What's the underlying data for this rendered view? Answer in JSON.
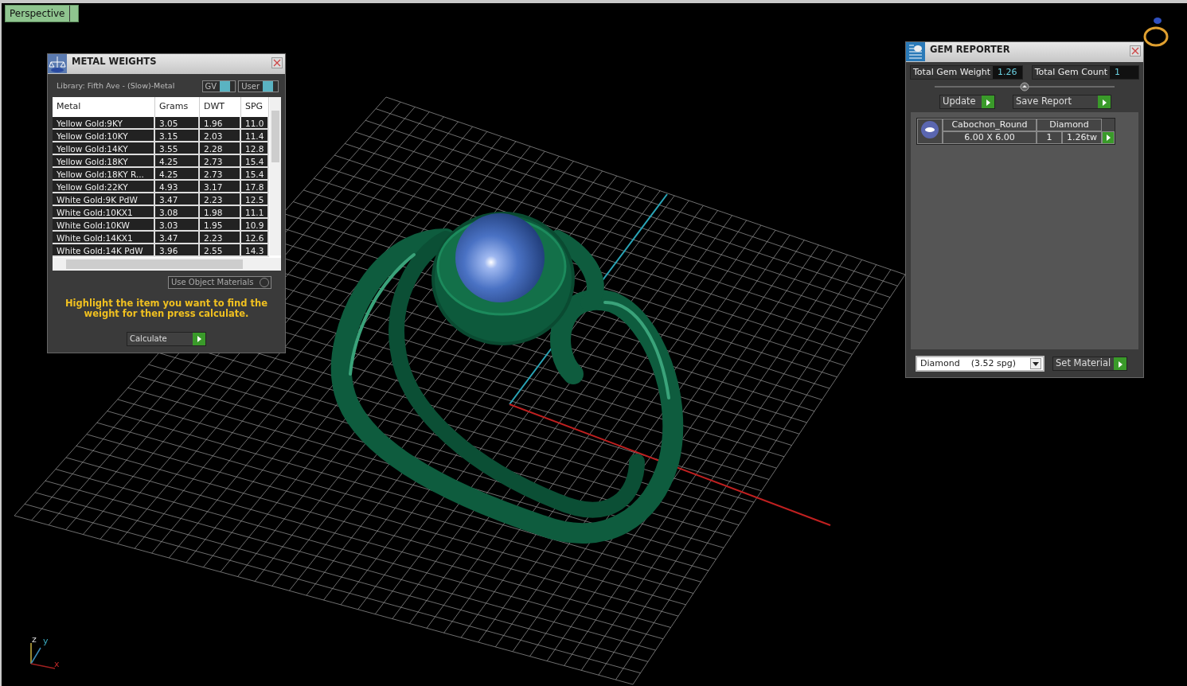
{
  "viewport": {
    "view_menu": "Perspective",
    "axes": [
      "z",
      "y",
      "x"
    ]
  },
  "metal_weights": {
    "title": "METAL WEIGHTS",
    "library": "Library: Fifth Ave - (Slow)-Metal",
    "toggles": [
      {
        "label": "GV",
        "on": true
      },
      {
        "label": "User",
        "on": true
      }
    ],
    "table": {
      "columns": [
        "Metal",
        "Grams",
        "DWT",
        "SPG"
      ],
      "rows": [
        [
          "Yellow Gold:9KY",
          "3.05",
          "1.96",
          "11.0"
        ],
        [
          "Yellow Gold:10KY",
          "3.15",
          "2.03",
          "11.4"
        ],
        [
          "Yellow Gold:14KY",
          "3.55",
          "2.28",
          "12.8"
        ],
        [
          "Yellow Gold:18KY",
          "4.25",
          "2.73",
          "15.4"
        ],
        [
          "Yellow Gold:18KY R...",
          "4.25",
          "2.73",
          "15.4"
        ],
        [
          "Yellow Gold:22KY",
          "4.93",
          "3.17",
          "17.8"
        ],
        [
          "White Gold:9K PdW",
          "3.47",
          "2.23",
          "12.5"
        ],
        [
          "White Gold:10KX1",
          "3.08",
          "1.98",
          "11.1"
        ],
        [
          "White Gold:10KW",
          "3.03",
          "1.95",
          "10.9"
        ],
        [
          "White Gold:14KX1",
          "3.47",
          "2.23",
          "12.6"
        ],
        [
          "White Gold:14K PdW",
          "3.96",
          "2.55",
          "14.3"
        ]
      ]
    },
    "use_object_materials": {
      "label": "Use Object Materials",
      "checked": false
    },
    "hint": "Highlight the item you want to find the weight for then press calculate.",
    "calculate_button": "Calculate"
  },
  "gem_reporter": {
    "title": "GEM REPORTER",
    "total_gem_weight": {
      "label": "Total Gem Weight",
      "value": "1.26"
    },
    "total_gem_count": {
      "label": "Total Gem Count",
      "value": "1"
    },
    "buttons": [
      "Update",
      "Save Report"
    ],
    "gems": [
      {
        "cut": "Cabochon_Round",
        "material": "Diamond",
        "size": "6.00 X 6.00",
        "count": "1",
        "weight": "1.26tw"
      }
    ],
    "material_select": "Diamond    (3.52 spg)",
    "set_material_button": "Set Material"
  }
}
